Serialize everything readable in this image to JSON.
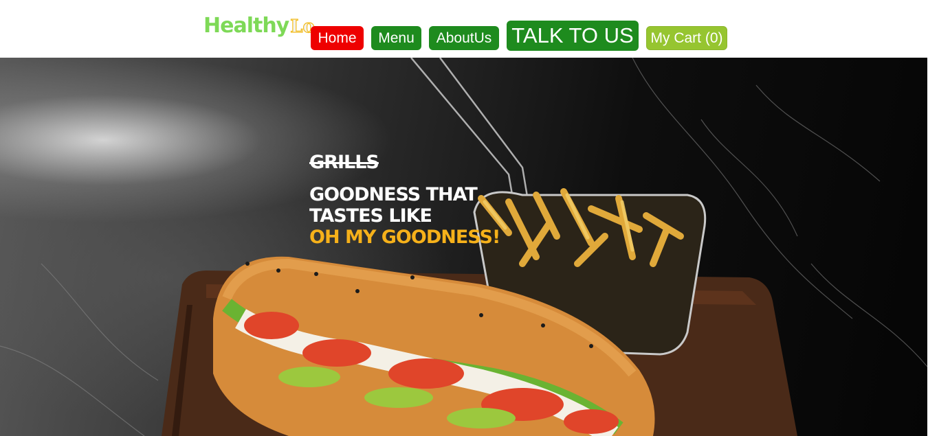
{
  "header": {
    "logo": {
      "part1": "Healthy",
      "part2": "Lo"
    },
    "nav": {
      "home": "Home",
      "menu": "Menu",
      "about": "AboutUs",
      "talk": "TALK TO US",
      "cart": "My Cart (0)"
    }
  },
  "hero": {
    "brand": "GRILLS",
    "line1": "GOODNESS THAT",
    "line2": "TASTES LIKE",
    "line3": "OH MY GOODNESS!"
  },
  "colors": {
    "home": "#ee0000",
    "nav_green": "#1e8b1e",
    "cart": "#96c530",
    "logo_green": "#7ed957",
    "accent_yellow": "#f6b11a"
  }
}
